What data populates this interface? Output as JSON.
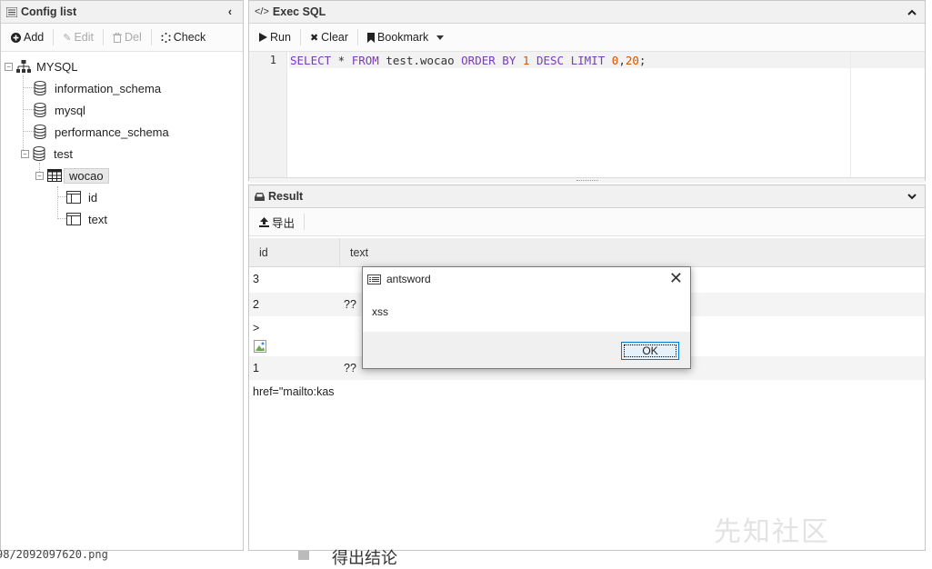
{
  "config_panel": {
    "title": "Config list",
    "toolbar": {
      "add": "Add",
      "edit": "Edit",
      "del": "Del",
      "check": "Check"
    },
    "tree": {
      "root": "MYSQL",
      "databases": [
        "information_schema",
        "mysql",
        "performance_schema",
        "test"
      ],
      "table": "wocao",
      "columns": [
        "id",
        "text"
      ]
    }
  },
  "sql_panel": {
    "title": "Exec SQL",
    "toolbar": {
      "run": "Run",
      "clear": "Clear",
      "bookmark": "Bookmark"
    },
    "editor": {
      "line_number": "1",
      "tokens": [
        {
          "t": "SELECT",
          "k": "kw"
        },
        {
          "t": " * ",
          "k": "plain"
        },
        {
          "t": "FROM",
          "k": "kw"
        },
        {
          "t": " test.wocao ",
          "k": "plain"
        },
        {
          "t": "ORDER BY",
          "k": "kw"
        },
        {
          "t": " ",
          "k": "plain"
        },
        {
          "t": "1",
          "k": "num"
        },
        {
          "t": " ",
          "k": "plain"
        },
        {
          "t": "DESC",
          "k": "kw"
        },
        {
          "t": " ",
          "k": "plain"
        },
        {
          "t": "LIMIT",
          "k": "kw"
        },
        {
          "t": " ",
          "k": "plain"
        },
        {
          "t": "0",
          "k": "num"
        },
        {
          "t": ",",
          "k": "plain"
        },
        {
          "t": "20",
          "k": "num"
        },
        {
          "t": ";",
          "k": "plain"
        }
      ]
    }
  },
  "result_panel": {
    "title": "Result",
    "export": "导出",
    "columns": [
      "id",
      "text"
    ],
    "rows": [
      {
        "id": "3",
        "text": ""
      },
      {
        "id": "2",
        "text": "??"
      },
      {
        "id": ">",
        "text": ""
      },
      {
        "id": "1",
        "text": "??"
      },
      {
        "id": "href=\"mailto:kas",
        "text": ""
      }
    ]
  },
  "dialog": {
    "title": "antsword",
    "message": "xss",
    "ok": "OK"
  },
  "background": {
    "left_footer": "98/2092097620.png",
    "right_footer": "得出结论",
    "watermark": "先知社区"
  },
  "colors": {
    "keyword": "#7a3bb6",
    "number": "#d35400",
    "dialog_focus": "#0078d7"
  }
}
